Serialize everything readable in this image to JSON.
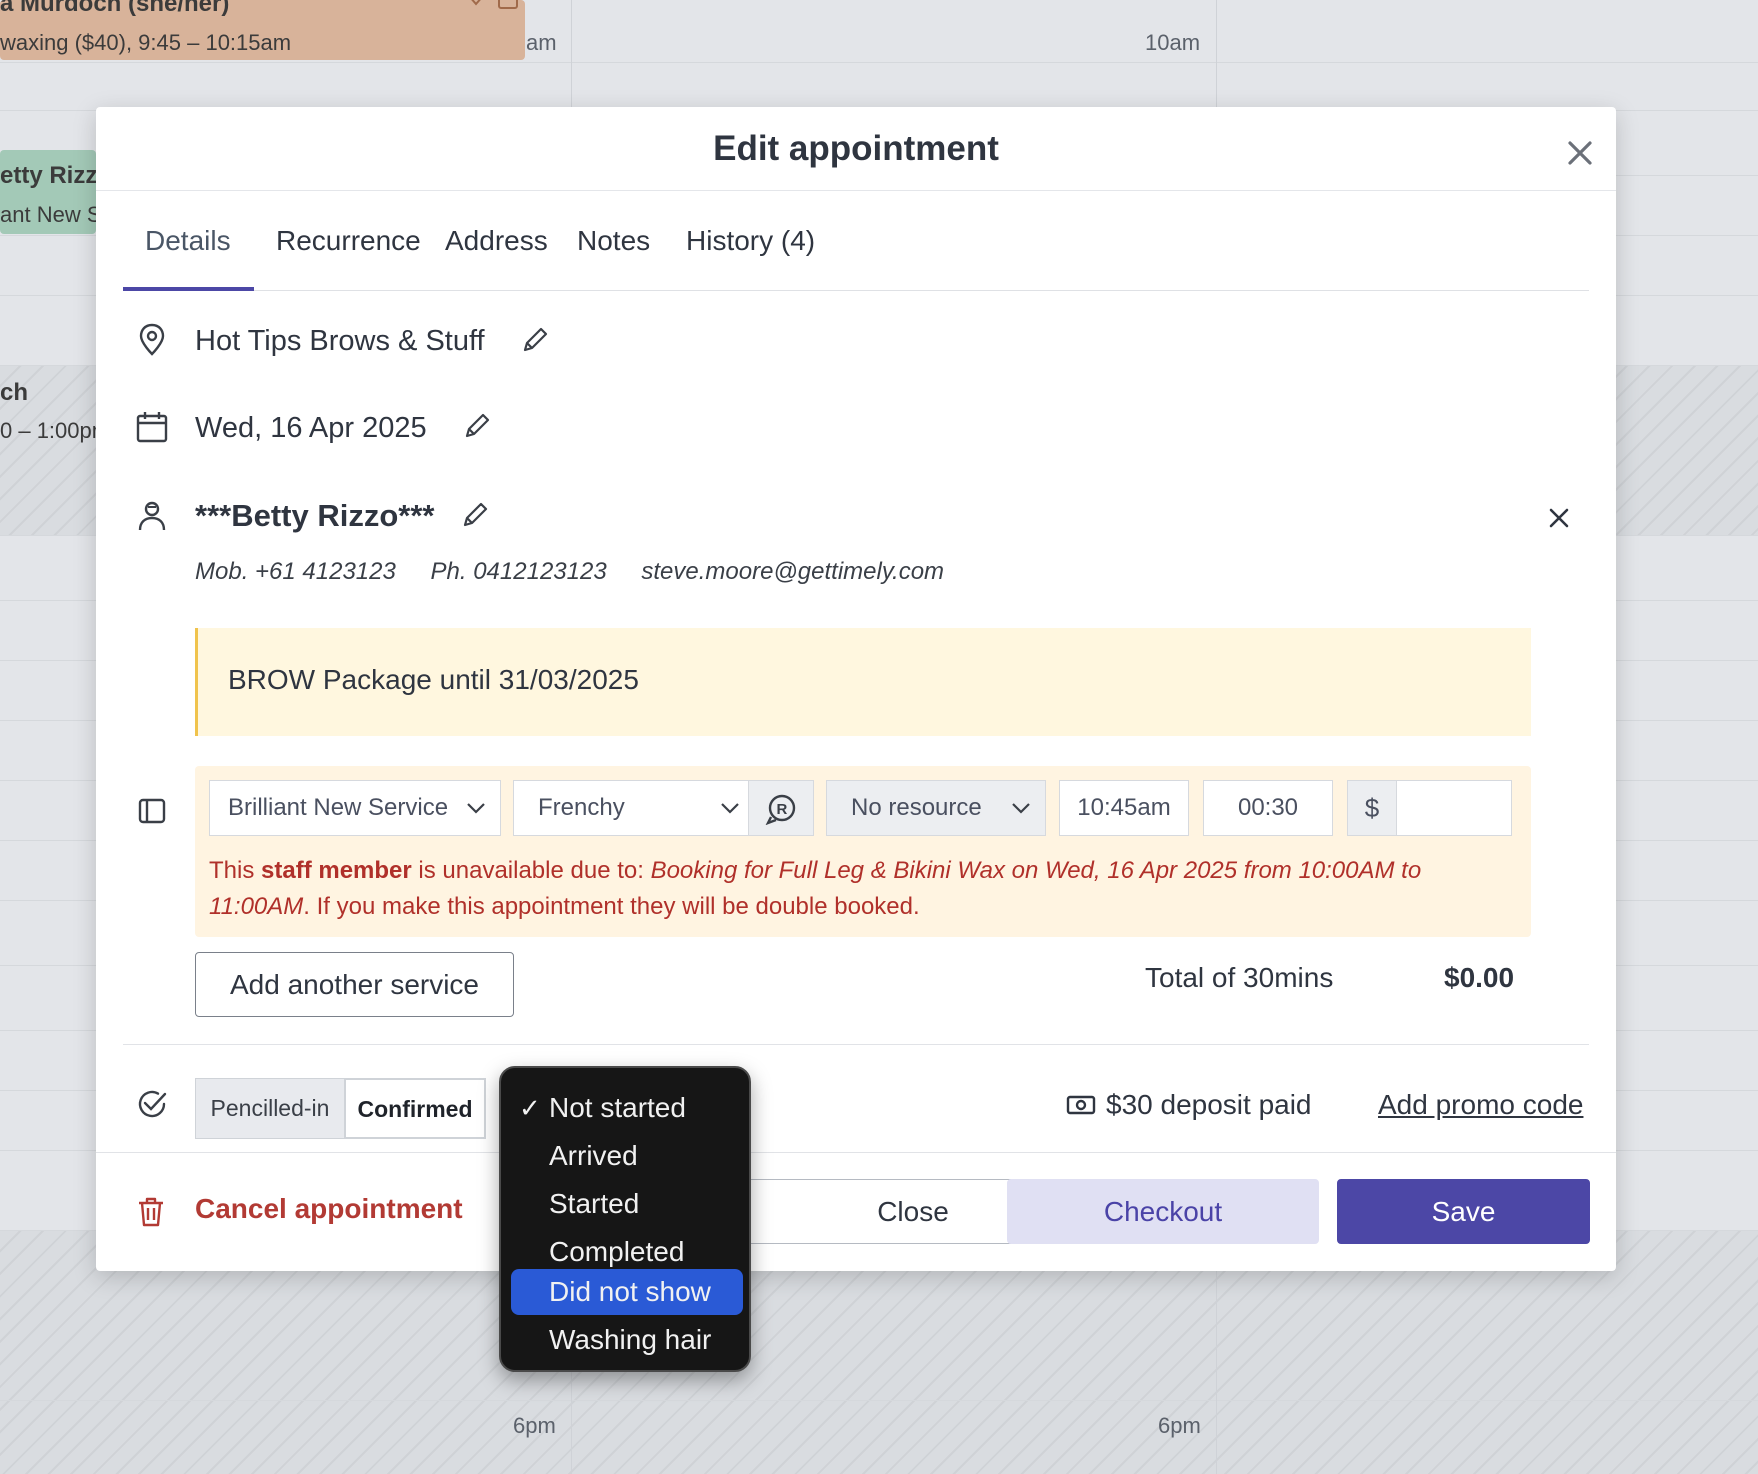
{
  "calendar": {
    "time_labels": [
      "am",
      "10am",
      "6pm",
      "6pm"
    ],
    "cards": [
      {
        "name": "a Murdoch (she/her)",
        "detail": "waxing ($40), 9:45 – 10:15am",
        "color": "#d8b39a"
      },
      {
        "name": "etty Rizz",
        "detail": "ant New S",
        "color": "#a3c9b7"
      },
      {
        "name": "ch",
        "detail": "0 – 1:00pm"
      }
    ]
  },
  "modal": {
    "title": "Edit appointment",
    "tabs": [
      {
        "label": "Details",
        "active": true
      },
      {
        "label": "Recurrence"
      },
      {
        "label": "Address"
      },
      {
        "label": "Notes"
      },
      {
        "label": "History (4)"
      }
    ],
    "location": "Hot Tips Brows & Stuff",
    "date": "Wed, 16 Apr 2025",
    "client": {
      "name": "***Betty Rizzo***",
      "mobile": "Mob. +61 4123123",
      "phone": "Ph. 0412123123",
      "email": "steve.moore@gettimely.com"
    },
    "note": "BROW Package until 31/03/2025",
    "service": {
      "service": "Brilliant New Service",
      "staff": "Frenchy",
      "resource": "No resource",
      "start": "10:45am",
      "duration": "00:30",
      "currency": "$",
      "price": "",
      "warning": {
        "pre": "This ",
        "bold": "staff member",
        "mid": " is unavailable due to: ",
        "italic": "Booking for Full Leg & Bikini Wax on Wed, 16 Apr 2025 from 10:00AM to 11:00AM",
        "post": ". If you make this appointment they will be double booked."
      }
    },
    "add_service_label": "Add another service",
    "total_label": "Total of 30mins",
    "total_value": "$0.00",
    "status": {
      "pencilled": "Pencilled-in",
      "confirmed": "Confirmed",
      "selected": "Confirmed"
    },
    "deposit": "$30 deposit paid",
    "promo": "Add promo code",
    "cancel_label": "Cancel appointment",
    "close_label": "Close",
    "checkout_label": "Checkout",
    "save_label": "Save"
  },
  "progress_menu": {
    "items": [
      "Not started",
      "Arrived",
      "Started",
      "Completed",
      "Did not show",
      "Washing hair"
    ],
    "checked": "Not started",
    "highlighted": "Did not show"
  },
  "colors": {
    "primary": "#4c47a6",
    "danger": "#b23a34",
    "warning_bg": "#fff4e1",
    "note_bg": "#fff7df",
    "menu_highlight": "#2a5ad6"
  }
}
